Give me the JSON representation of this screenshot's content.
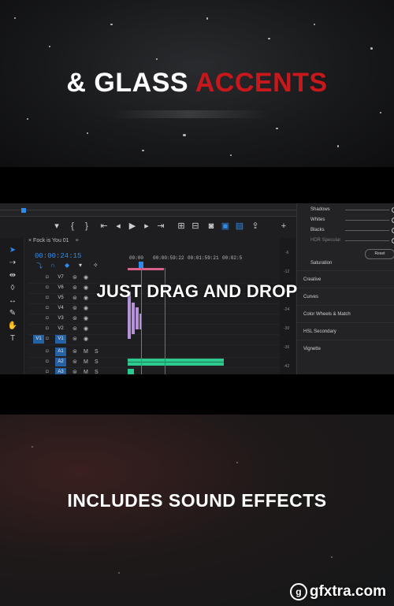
{
  "panel1": {
    "headline_white": "& GLASS",
    "headline_accent": "ACCENTS",
    "accent_color": "#c8181c"
  },
  "editor": {
    "sequence_name": "Fock is You 01",
    "timecode": "00:00:24:15",
    "ruler_ticks": [
      "00:00",
      "00:00:59:22",
      "00:01:59:21",
      "00:02:5"
    ],
    "tools": [
      "selection-tool",
      "track-select-tool",
      "ripple-edit-tool",
      "razor-tool",
      "slip-tool",
      "pen-tool",
      "hand-tool",
      "type-tool"
    ],
    "video_tracks": [
      "V7",
      "V6",
      "V5",
      "V4",
      "V3",
      "V2",
      "V1"
    ],
    "audio_tracks": [
      "A1",
      "A2",
      "A3"
    ],
    "source_patch": "V1",
    "audio_track_buttons": [
      "M",
      "S"
    ],
    "scale_values": [
      "-6",
      "-12",
      "-18",
      "-24",
      "-30",
      "-36",
      "-42"
    ],
    "lumetri": {
      "sliders": [
        "Shadows",
        "Whites",
        "Blacks",
        "HDR Specular"
      ],
      "reset_label": "Reset",
      "saturation_label": "Saturation",
      "sections": [
        "Creative",
        "Curves",
        "Color Wheels & Match",
        "HSL Secondary",
        "Vignette"
      ]
    }
  },
  "overlay_caption": "JUST DRAG AND DROP",
  "panel4": {
    "caption": "INCLUDES SOUND EFFECTS"
  },
  "watermark": {
    "text": "gfxtra.com"
  },
  "icons": {
    "transport": [
      "marker-icon",
      "in-point-icon",
      "out-point-icon",
      "go-to-in-icon",
      "step-back-icon",
      "play-icon",
      "step-forward-icon",
      "go-to-out-icon",
      "insert-icon",
      "overwrite-icon",
      "export-frame-icon",
      "compare-icon",
      "settings-icon",
      "add-button-icon"
    ]
  }
}
